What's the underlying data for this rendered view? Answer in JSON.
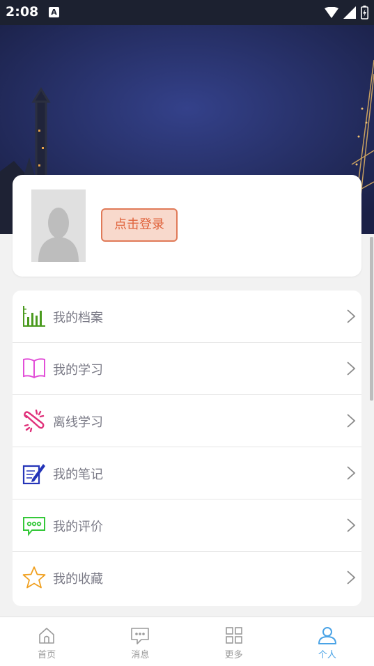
{
  "status": {
    "time": "2:08",
    "notification_badge": "A"
  },
  "profile": {
    "login_label": "点击登录"
  },
  "menu": {
    "items": [
      {
        "label": "我的档案",
        "icon": "bar-chart-icon",
        "color": "#4a9a1e"
      },
      {
        "label": "我的学习",
        "icon": "open-book-icon",
        "color": "#e24fd8"
      },
      {
        "label": "离线学习",
        "icon": "offline-link-icon",
        "color": "#e0307a"
      },
      {
        "label": "我的笔记",
        "icon": "notepad-pen-icon",
        "color": "#2434b8"
      },
      {
        "label": "我的评价",
        "icon": "chat-bubble-icon",
        "color": "#35c83a"
      },
      {
        "label": "我的收藏",
        "icon": "star-icon",
        "color": "#f0a020"
      }
    ]
  },
  "tabs": [
    {
      "label": "首页",
      "icon": "home-icon"
    },
    {
      "label": "消息",
      "icon": "message-icon"
    },
    {
      "label": "更多",
      "icon": "grid-icon"
    },
    {
      "label": "个人",
      "icon": "person-icon",
      "active": true,
      "color": "#4aa3e6"
    }
  ]
}
